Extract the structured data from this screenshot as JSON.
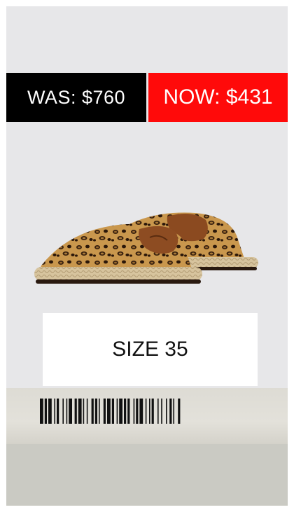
{
  "prices": {
    "was_label": "WAS: $760",
    "now_label": "NOW: $431"
  },
  "size_label": "SIZE 35",
  "colors": {
    "was_bg": "#000000",
    "now_bg": "#ff0a0a",
    "frame_bg": "#e7e7e9"
  },
  "icons": {
    "product": "leopard-espadrille-mules",
    "barcode": "barcode"
  }
}
